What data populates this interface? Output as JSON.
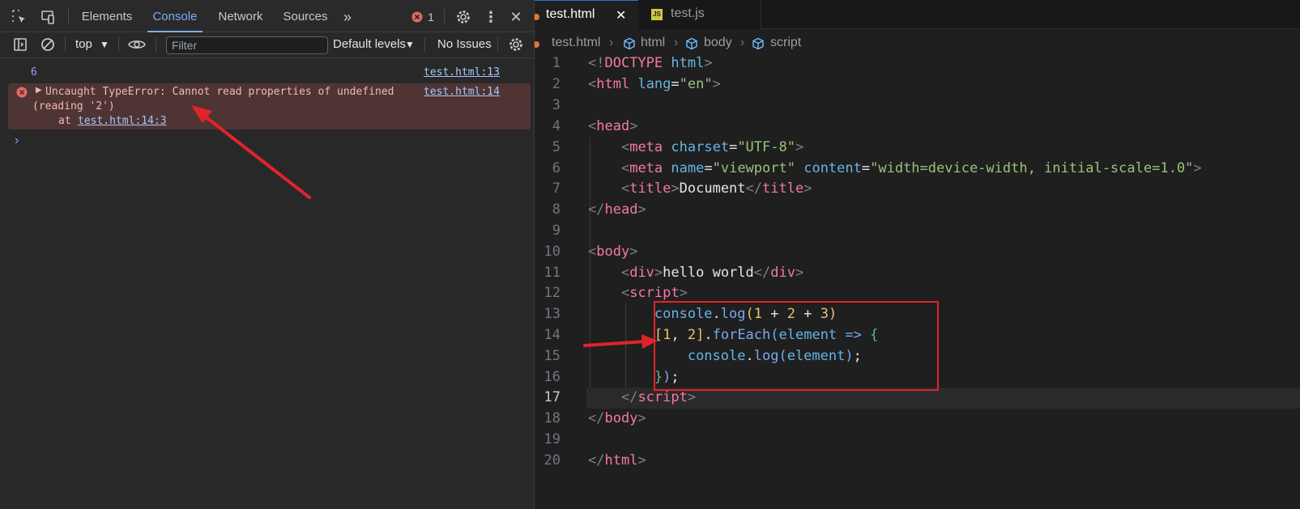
{
  "devtools": {
    "tabs": [
      {
        "label": "Elements"
      },
      {
        "label": "Console"
      },
      {
        "label": "Network"
      },
      {
        "label": "Sources"
      }
    ],
    "more_tabs_icon": "chevron-double-right-icon",
    "error_count": "1",
    "toolbar": {
      "context": "top",
      "filter_placeholder": "Filter",
      "levels": "Default levels",
      "issues": "No Issues"
    },
    "console": {
      "log_value": "6",
      "log_source": "test.html:13",
      "error_line1": "Uncaught TypeError: Cannot read properties of undefined",
      "error_line2": "(reading '2')",
      "error_at": "at ",
      "error_at_link": "test.html:14:3",
      "error_source": "test.html:14",
      "prompt": "›"
    }
  },
  "editor": {
    "tabs": [
      {
        "label": "test.html",
        "close": "✕"
      },
      {
        "label": "test.js"
      }
    ],
    "breadcrumb": [
      "test.html",
      "html",
      "body",
      "script"
    ],
    "current_line": "17",
    "line_numbers": [
      "1",
      "2",
      "3",
      "4",
      "5",
      "6",
      "7",
      "8",
      "9",
      "10",
      "11",
      "12",
      "13",
      "14",
      "15",
      "16",
      "17",
      "18",
      "19",
      "20"
    ]
  },
  "colors": {
    "accent": "#7cacf8",
    "error_bg": "#4e3534",
    "annotation_red": "#e0242a"
  }
}
